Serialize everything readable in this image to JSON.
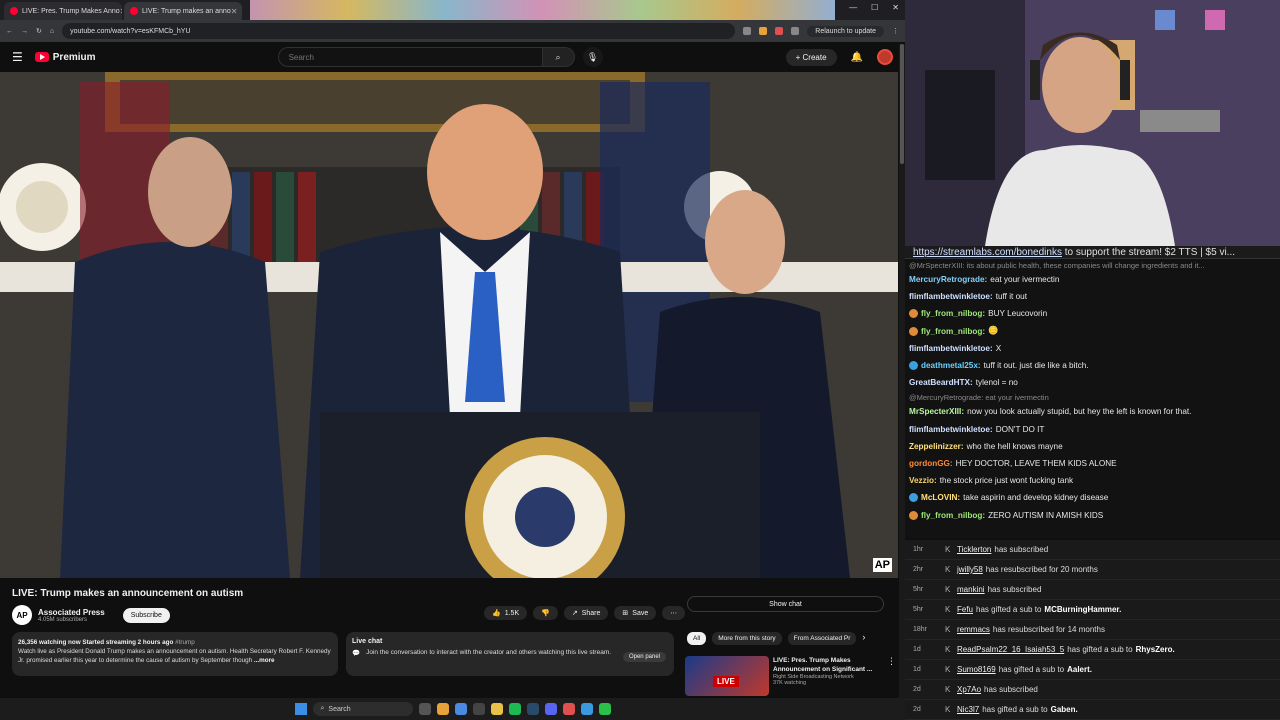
{
  "browser": {
    "tabs": [
      {
        "title": "LIVE: Pres. Trump Makes Anno"
      },
      {
        "title": "LIVE: Trump makes an anno"
      }
    ],
    "url": "youtube.com/watch?v=esKFMCb_hYU",
    "relaunch_label": "Relaunch to update"
  },
  "yt": {
    "logo_text": "Premium",
    "search_placeholder": "Search",
    "create_label": "Create"
  },
  "video": {
    "title": "LIVE: Trump makes an announcement on autism",
    "watermark": "AP",
    "channel_name": "Associated Press",
    "channel_initials": "AP",
    "subscribers": "4.05M subscribers",
    "subscribe_label": "Subscribe",
    "likes": "1.5K",
    "share_label": "Share",
    "save_label": "Save",
    "desc_stats": "26,356 watching now  Started streaming 2 hours ago",
    "desc_tag": "#trump",
    "desc_text": "Watch live as President Donald Trump makes an announcement on autism. Health Secretary Robert F. Kennedy Jr. promised earlier this year to determine the cause of autism by September though",
    "desc_more": "...more"
  },
  "livechat": {
    "title": "Live chat",
    "text": "Join the conversation to interact with the creator and others watching this live stream.",
    "open_label": "Open panel",
    "show_chat": "Show chat"
  },
  "chips": [
    "All",
    "More from this story",
    "From Associated Pr"
  ],
  "recommended": {
    "title": "LIVE: Pres. Trump Makes Announcement on Significant ...",
    "channel": "Right Side Broadcasting Network",
    "watching": "37K watching",
    "tag": "LIVE"
  },
  "taskbar": {
    "search": "Search"
  },
  "chat": {
    "banner_link": "https://streamlabs.com/bonedinks",
    "banner_text": " to support the stream! $2 TTS | $5 vi...",
    "messages": [
      {
        "kind": "reply",
        "text": "@MrSpecterXIII: its about public health, these companies will change ingredients and it..."
      },
      {
        "user": "MercuryRetrograde:",
        "color": "#7fd1ff",
        "text": " eat your ivermectin"
      },
      {
        "user": "flimflambetwinkletoe:",
        "color": "#cfe0ff",
        "text": " tuff it out"
      },
      {
        "user": "fly_from_nilbog:",
        "color": "#9fe87a",
        "badge": "#e08a3a",
        "text": " BUY Leucovorin"
      },
      {
        "user": "fly_from_nilbog:",
        "color": "#9fe87a",
        "badge": "#e08a3a",
        "text": " 🪙"
      },
      {
        "user": "flimflambetwinkletoe:",
        "color": "#cfe0ff",
        "text": " X"
      },
      {
        "user": "deathmetal25x:",
        "color": "#6ad0ff",
        "badge": "#3aa0e0",
        "text": " tuff it out. just die like a bitch."
      },
      {
        "user": "GreatBeardHTX:",
        "color": "#cfe0ff",
        "text": " tylenol = no"
      },
      {
        "kind": "reply",
        "text": "@MercuryRetrograde: eat your ivermectin"
      },
      {
        "user": "MrSpecterXIII:",
        "color": "#b9f7a0",
        "text": " now you look actually stupid, but hey the left is known for that."
      },
      {
        "user": "flimflambetwinkletoe:",
        "color": "#cfe0ff",
        "text": " DON'T DO IT"
      },
      {
        "user": "Zeppelinizzer:",
        "color": "#ffe17a",
        "text": " who the hell knows mayne"
      },
      {
        "user": "gordonGG:",
        "color": "#ff8a3a",
        "text": " HEY DOCTOR, LEAVE THEM KIDS ALONE"
      },
      {
        "user": "Vezzio:",
        "color": "#f5d36b",
        "text": " the stock price just wont fucking tank"
      },
      {
        "user": "McLOVIN:",
        "color": "#ffe17a",
        "badge": "#3aa0e0",
        "text": " take aspirin and develop kidney disease"
      },
      {
        "user": "fly_from_nilbog:",
        "color": "#9fe87a",
        "badge": "#e08a3a",
        "text": " ZERO AUTISM IN AMISH KIDS"
      }
    ]
  },
  "events": [
    {
      "time": "1hr",
      "name": "Ticklerton",
      "text": "has subscribed",
      "target": ""
    },
    {
      "time": "2hr",
      "name": "jwilly58",
      "text": "has resubscribed for 20 months",
      "target": ""
    },
    {
      "time": "5hr",
      "name": "mankini",
      "text": "has subscribed",
      "target": ""
    },
    {
      "time": "5hr",
      "name": "Fefu",
      "text": "has gifted a sub to",
      "target": "MCBurningHammer."
    },
    {
      "time": "18hr",
      "name": "remmacs",
      "text": "has resubscribed for 14 months",
      "target": ""
    },
    {
      "time": "1d",
      "name": "ReadPsalm22_16_Isaiah53_5",
      "text": "has gifted a sub to",
      "target": "RhysZero."
    },
    {
      "time": "1d",
      "name": "Sumo8169",
      "text": "has gifted a sub to",
      "target": "Aalert."
    },
    {
      "time": "2d",
      "name": "Xp7Ao",
      "text": "has subscribed",
      "target": ""
    },
    {
      "time": "2d",
      "name": "Nic3l7",
      "text": "has gifted a sub to",
      "target": "Gaben."
    }
  ]
}
